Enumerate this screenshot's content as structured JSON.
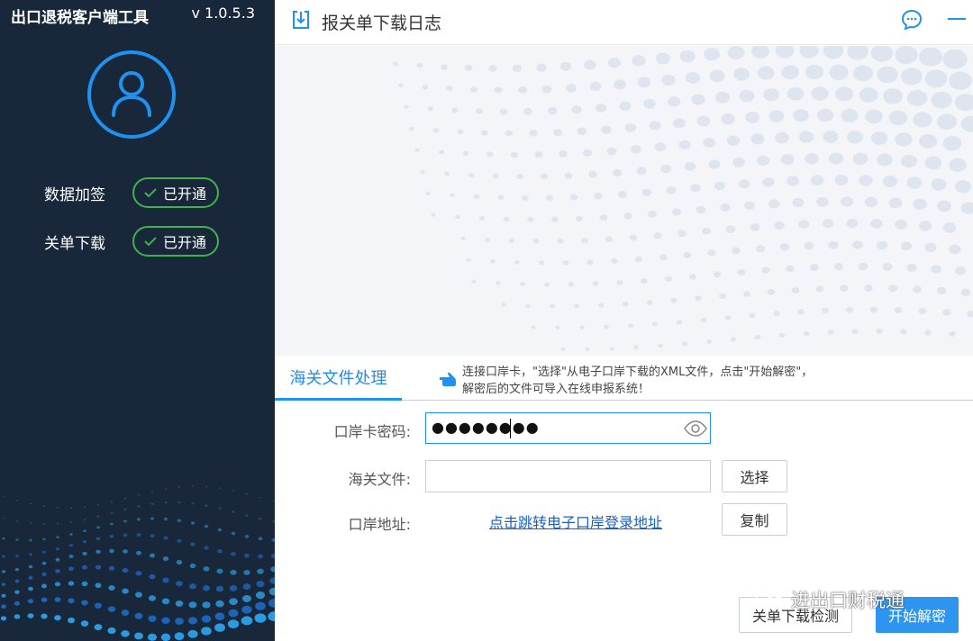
{
  "sidebar": {
    "app_title": "出口退税客户端工具",
    "version": "v 1.0.5.3",
    "features": [
      {
        "label": "数据加签",
        "status": "已开通"
      },
      {
        "label": "关单下载",
        "status": "已开通"
      }
    ]
  },
  "topbar": {
    "title": "报关单下载日志",
    "icons": [
      "download-log-icon",
      "chat-icon",
      "minimize-icon"
    ]
  },
  "tabs": [
    {
      "label": "海关文件处理",
      "active": true
    }
  ],
  "hint": {
    "line1": "连接口岸卡，\"选择\"从电子口岸下载的XML文件，点击\"开始解密\"，",
    "line2": "解密后的文件可导入在线申报系统！"
  },
  "form": {
    "password_label": "口岸卡密码:",
    "password_value": "●●●●●●●●",
    "file_label": "海关文件:",
    "file_value": "",
    "address_label": "口岸地址:",
    "address_link": "点击跳转电子口岸登录地址",
    "select_button": "选择",
    "copy_button": "复制"
  },
  "actions": {
    "check_button": "关单下载检测",
    "decrypt_button": "开始解密"
  },
  "watermark": "进出口财税通",
  "colors": {
    "sidebar_bg": "#18283a",
    "accent": "#1f92f0",
    "success": "#3fb24f",
    "link": "#1a5fc4"
  }
}
